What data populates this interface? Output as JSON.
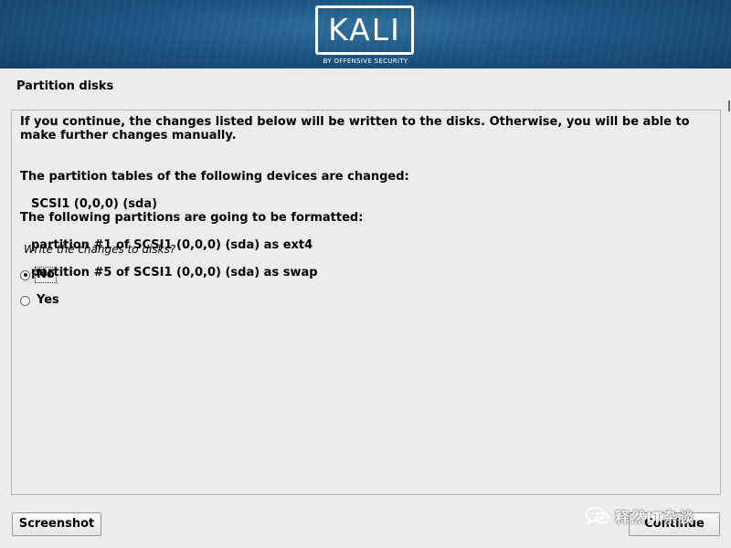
{
  "header": {
    "logo_text": "KALI",
    "logo_subtitle": "BY OFFENSIVE SECURITY"
  },
  "page": {
    "title": "Partition disks"
  },
  "content": {
    "intro": "If you continue, the changes listed below will be written to the disks. Otherwise, you will be able to make further changes manually.",
    "tables_heading": "The partition tables of the following devices are changed:",
    "tables_devices": [
      "SCSI1 (0,0,0) (sda)"
    ],
    "format_heading": "The following partitions are going to be formatted:",
    "format_partitions": [
      "partition #1 of SCSI1 (0,0,0) (sda) as ext4",
      "partition #5 of SCSI1 (0,0,0) (sda) as swap"
    ],
    "question": "Write the changes to disks?",
    "options": [
      {
        "label": "No",
        "selected": true
      },
      {
        "label": "Yes",
        "selected": false
      }
    ]
  },
  "buttons": {
    "screenshot_label": "Screenshot",
    "continue_label": "Continue"
  },
  "watermark": {
    "text": "释然IT杂谈",
    "icon": "wechat-icon"
  },
  "colors": {
    "banner": "#1d5684",
    "background": "#edeceb",
    "panel_border": "#b7b5b2"
  }
}
